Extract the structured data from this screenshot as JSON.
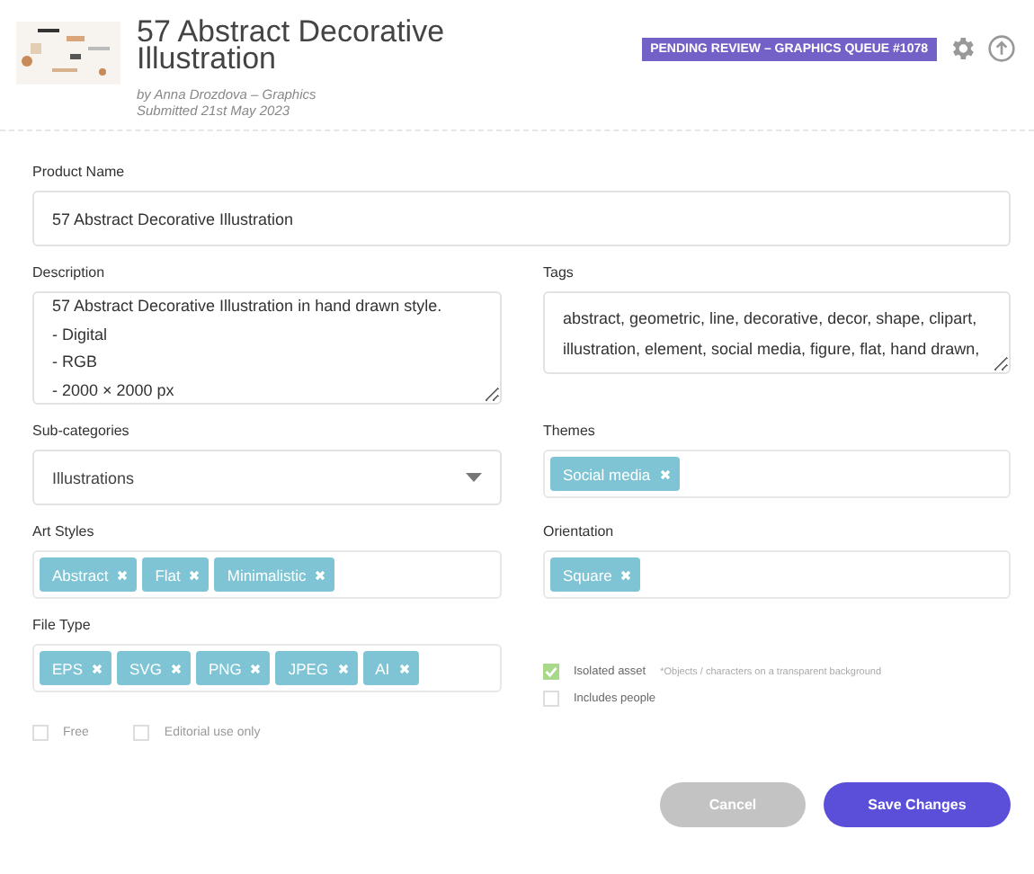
{
  "header": {
    "title": "57 Abstract Decorative Illustration",
    "byline": "by Anna Drozdova – Graphics",
    "submitted": "Submitted 21st May 2023",
    "status_badge": "PENDING REVIEW – GRAPHICS QUEUE #1078"
  },
  "product_name": {
    "label": "Product Name",
    "value": "57 Abstract Decorative Illustration"
  },
  "description": {
    "label": "Description",
    "value": "57 Abstract Decorative Illustration in hand drawn style.\n- Digital\n- RGB\n- 2000 × 2000 px"
  },
  "tags": {
    "label": "Tags",
    "value": "abstract, geometric, line, decorative, decor, shape, clipart, illustration, element, social media, figure, flat, hand drawn,"
  },
  "sub_categories": {
    "label": "Sub-categories",
    "value": "Illustrations"
  },
  "themes": {
    "label": "Themes",
    "chips": [
      "Social media"
    ]
  },
  "art_styles": {
    "label": "Art Styles",
    "chips": [
      "Abstract",
      "Flat",
      "Minimalistic"
    ]
  },
  "orientation": {
    "label": "Orientation",
    "chips": [
      "Square"
    ]
  },
  "file_type": {
    "label": "File Type",
    "chips": [
      "EPS",
      "SVG",
      "PNG",
      "JPEG",
      "AI"
    ]
  },
  "asset_options": [
    {
      "label": "Isolated asset",
      "note": "*Objects / characters on a transparent background",
      "checked": true
    },
    {
      "label": "Includes people",
      "checked": false
    }
  ],
  "license_options": [
    {
      "label": "Free",
      "checked": false
    },
    {
      "label": "Editorial use only",
      "checked": false
    }
  ],
  "buttons": {
    "cancel": "Cancel",
    "save": "Save Changes"
  }
}
